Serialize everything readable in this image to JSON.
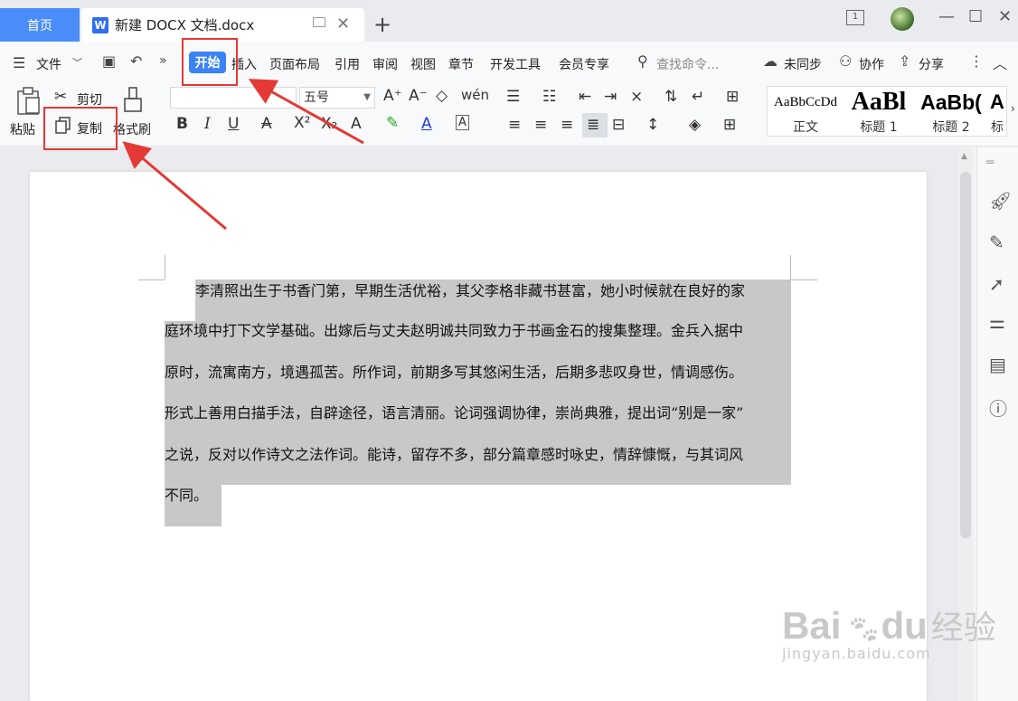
{
  "tabs": {
    "home": "首页",
    "doc_title": "新建 DOCX 文档.docx",
    "new_tab": "+",
    "close": "✕"
  },
  "window": {
    "layout_badge": "1",
    "minimize": "—",
    "maximize": "☐",
    "close": "✕"
  },
  "menu": {
    "file": "文件",
    "items": [
      "开始",
      "插入",
      "页面布局",
      "引用",
      "审阅",
      "视图",
      "章节",
      "开发工具",
      "会员专享"
    ],
    "search_placeholder": "查找命令...",
    "sync": "未同步",
    "collab": "协作",
    "share": "分享"
  },
  "ribbon": {
    "paste": "粘贴",
    "cut": "剪切",
    "copy": "复制",
    "format_painter": "格式刷",
    "font_size": "五号",
    "styles": [
      {
        "preview": "AaBbCcDd",
        "name": "正文"
      },
      {
        "preview": "AaBl",
        "name": "标题 1"
      },
      {
        "preview": "AaBb(",
        "name": "标题 2"
      },
      {
        "preview": "A",
        "name": "标"
      }
    ]
  },
  "document": {
    "lines": [
      "李清照出生于书香门第，早期生活优裕，其父李格非藏书甚富，她小时候就在良好的家",
      "庭环境中打下文学基础。出嫁后与丈夫赵明诚共同致力于书画金石的搜集整理。金兵入据中",
      "原时，流寓南方，境遇孤苦。所作词，前期多写其悠闲生活，后期多悲叹身世，情调感伤。",
      "形式上善用白描手法，自辟途径，语言清丽。论词强调协律，崇尚典雅，提出词“别是一家”",
      "之说，反对以作诗文之法作词。能诗，留存不多，部分篇章感时咏史，情辞慷慨，与其词风",
      "不同。"
    ]
  },
  "watermark": {
    "brand": "Bai",
    "brand2": "du",
    "cn": "经验",
    "url": "jingyan.baidu.com"
  },
  "colors": {
    "accent": "#3b82f6",
    "annotation": "#e53935",
    "selection": "#c8c8c8"
  }
}
